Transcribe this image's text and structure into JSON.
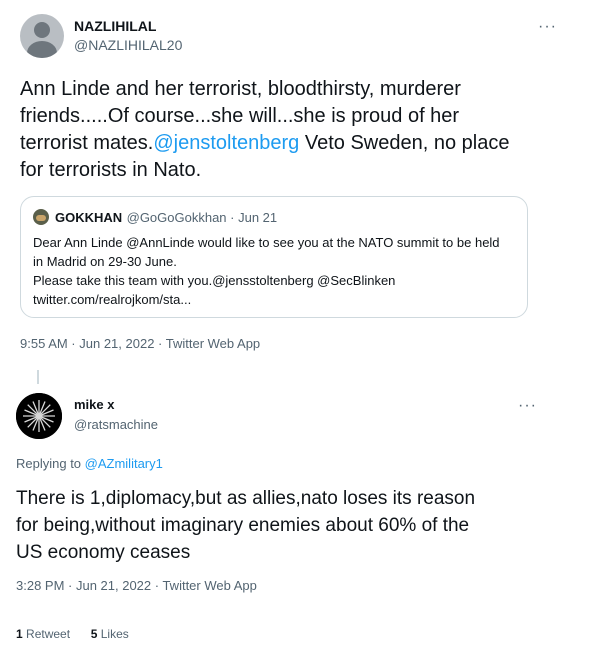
{
  "tweet1": {
    "name": "NAZLIHILAL",
    "handle": "@NAZLIHILAL20",
    "more": "···",
    "lines": [
      "Ann Linde and her terrorist, bloodthirsty, murderer",
      "friends.....Of course...she will...she is proud of her",
      "terrorist mates.",
      " Veto Sweden, no place",
      "for terrorists in Nato."
    ],
    "mention": "@jenstoltenberg",
    "timestamp": "9:55 AM · Jun 21, 2022 · Twitter Web App"
  },
  "quote": {
    "name": "GOKKHAN",
    "handle": "@GoGoGokkhan · Jun 21",
    "body": "Dear Ann Linde @AnnLinde would like to see you at the NATO summit to be held\nin Madrid on 29-30 June.\nPlease take this team with you.@jensstoltenberg @SecBlinken\ntwitter.com/realrojkom/sta..."
  },
  "tweet2": {
    "name": "mike x",
    "handle": "@ratsmachine",
    "more": "···",
    "replying_prefix": "Replying to ",
    "replying_to": "@AZmilitary1",
    "lines": [
      "There is 1,diplomacy,but as allies,nato loses its reason",
      "for being,without imaginary enemies about 60% of the",
      "US economy ceases"
    ],
    "timestamp": "3:28 PM · Jun 21, 2022 · Twitter Web App",
    "retweets_count": "1",
    "retweets_label": " Retweet",
    "likes_count": "5",
    "likes_label": " Likes"
  },
  "colors": {
    "link": "#1d9bf0",
    "secondary_text": "#536471",
    "border": "#cfd9de"
  }
}
